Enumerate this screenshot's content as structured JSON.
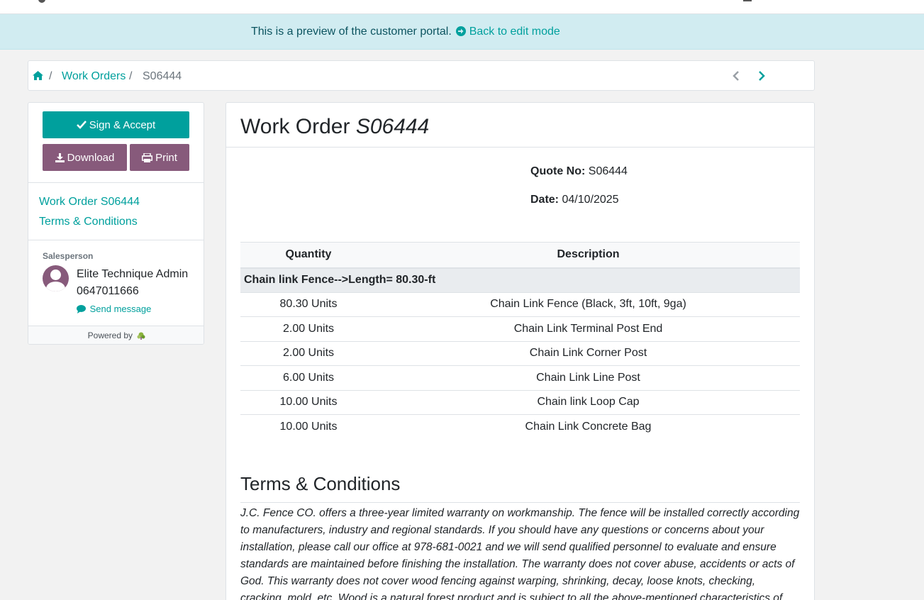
{
  "preview": {
    "message": "This is a preview of the customer portal.",
    "back_link": "Back to edit mode"
  },
  "breadcrumb": {
    "parent": "Work Orders",
    "current": "S06444"
  },
  "sidebar": {
    "sign_label": "Sign & Accept",
    "download_label": "Download",
    "print_label": "Print",
    "links": [
      "Work Order S06444",
      "Terms & Conditions"
    ],
    "salesperson_label": "Salesperson",
    "salesperson_name": "Elite Technique Admin",
    "salesperson_phone": "0647011666",
    "send_message": "Send message",
    "powered_by": "Powered by"
  },
  "order": {
    "title_prefix": "Work Order",
    "number": "S06444",
    "quote_label": "Quote No:",
    "quote_value": "S06444",
    "date_label": "Date:",
    "date_value": "04/10/2025"
  },
  "table": {
    "headers": [
      "Quantity",
      "Description"
    ],
    "section": "Chain link Fence-->Length= 80.30-ft",
    "rows": [
      {
        "qty": "80.30 Units",
        "desc": "Chain Link Fence (Black, 3ft, 10ft, 9ga)"
      },
      {
        "qty": "2.00 Units",
        "desc": "Chain Link Terminal Post End"
      },
      {
        "qty": "2.00 Units",
        "desc": "Chain Link Corner Post"
      },
      {
        "qty": "6.00 Units",
        "desc": "Chain Link Line Post"
      },
      {
        "qty": "10.00 Units",
        "desc": "Chain link Loop Cap"
      },
      {
        "qty": "10.00 Units",
        "desc": "Chain Link Concrete Bag"
      }
    ]
  },
  "terms": {
    "title": "Terms & Conditions",
    "text": "J.C. Fence CO. offers a three-year limited warranty on workmanship. The fence will be installed correctly according to manufacturers, industry and regional standards. If you should have any questions or concerns about your installation, please call our office at 978-681-0021 and we will send qualified personnel to evaluate and ensure standards are maintained before finishing the installation. The warranty does not cover abuse, accidents or acts of God. This warranty does not cover wood fencing against warping, shrinking, decay, loose knots, checking, cracking, mold, etc. Wood is a natural forest product and is subject to all the above-mentioned characteristics of harvested"
  },
  "colors": {
    "primary": "#00a09d",
    "secondary": "#875a7b",
    "info_bg": "#d1ecf1"
  }
}
